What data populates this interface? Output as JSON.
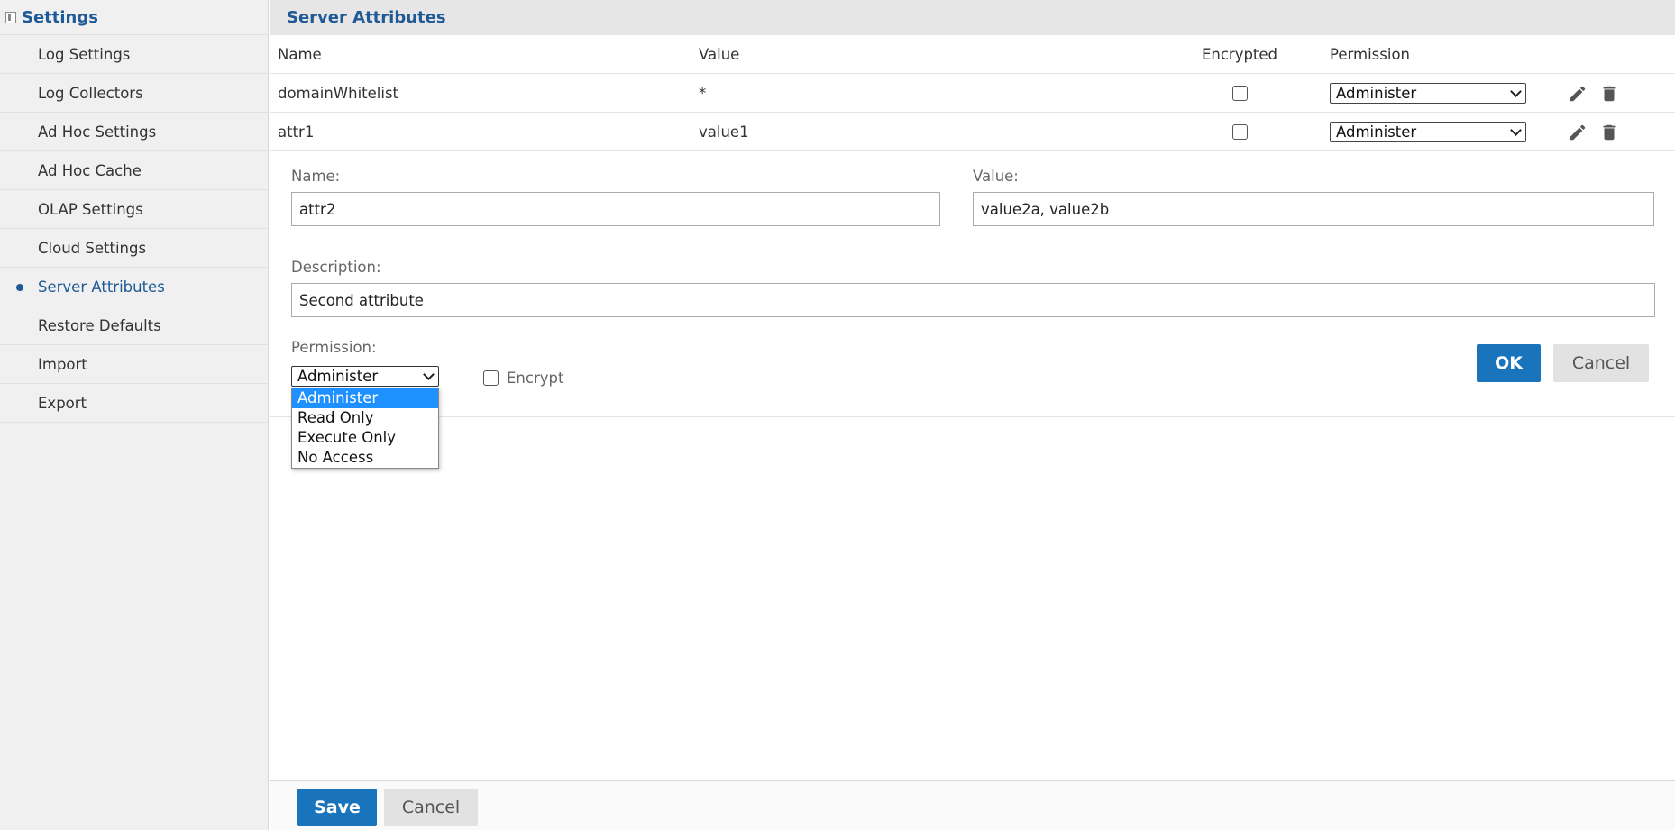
{
  "sidebar": {
    "title": "Settings",
    "items": [
      {
        "label": "Log Settings"
      },
      {
        "label": "Log Collectors"
      },
      {
        "label": "Ad Hoc Settings"
      },
      {
        "label": "Ad Hoc Cache"
      },
      {
        "label": "OLAP Settings"
      },
      {
        "label": "Cloud Settings"
      },
      {
        "label": "Server Attributes",
        "active": true
      },
      {
        "label": "Restore Defaults"
      },
      {
        "label": "Import"
      },
      {
        "label": "Export"
      }
    ]
  },
  "main": {
    "title": "Server Attributes",
    "columns": {
      "name": "Name",
      "value": "Value",
      "encrypted": "Encrypted",
      "permission": "Permission"
    },
    "rows": [
      {
        "name": "domainWhitelist",
        "value": "*",
        "encrypted": false,
        "permission": "Administer"
      },
      {
        "name": "attr1",
        "value": "value1",
        "encrypted": false,
        "permission": "Administer"
      }
    ],
    "form": {
      "name_label": "Name:",
      "name_value": "attr2",
      "value_label": "Value:",
      "value_value": "value2a, value2b",
      "description_label": "Description:",
      "description_value": "Second attribute",
      "permission_label": "Permission:",
      "permission_selected": "Administer",
      "permission_options": [
        "Administer",
        "Read Only",
        "Execute Only",
        "No Access"
      ],
      "encrypt_label": "Encrypt",
      "ok_label": "OK",
      "cancel_label": "Cancel"
    },
    "footer": {
      "save_label": "Save",
      "cancel_label": "Cancel"
    }
  },
  "colors": {
    "accent": "#1f5a96",
    "primary_button": "#1a74bc",
    "highlight": "#1e90ff"
  },
  "icons": {
    "edit": "pencil-icon",
    "delete": "trash-icon",
    "collapse": "collapse-panel-icon"
  }
}
